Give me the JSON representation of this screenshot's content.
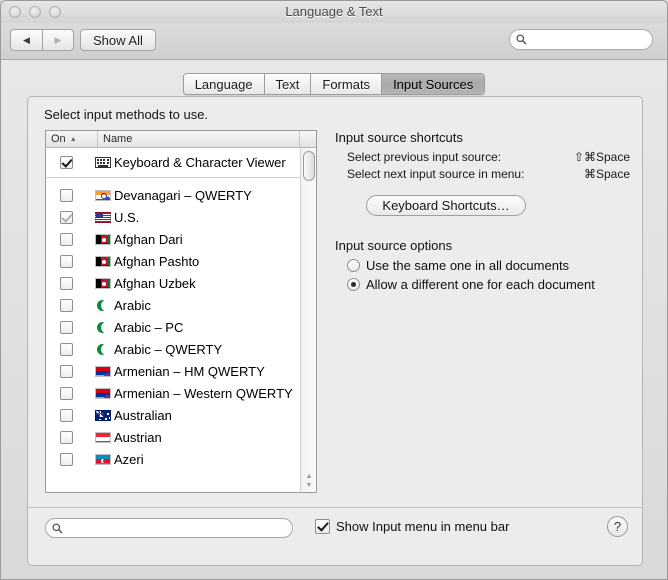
{
  "window": {
    "title": "Language & Text",
    "traffic_lights": [
      "close-button",
      "minimize-button",
      "zoom-button"
    ]
  },
  "toolbar": {
    "back_label": "◀",
    "forward_label": "▶",
    "show_all_label": "Show All",
    "search_value": "",
    "search_placeholder": ""
  },
  "tabs": [
    {
      "label": "Language",
      "active": false
    },
    {
      "label": "Text",
      "active": false
    },
    {
      "label": "Formats",
      "active": false
    },
    {
      "label": "Input Sources",
      "active": true
    }
  ],
  "main": {
    "prompt": "Select input methods to use.",
    "list_headers": {
      "on": "On",
      "sort_arrow": "▲",
      "name": "Name"
    },
    "input_methods": [
      {
        "name": "Keyboard & Character Viewer",
        "checked": true,
        "dim": false,
        "icon": "keyboard-viewer-icon",
        "separator": true
      },
      {
        "name": "Devanagari – QWERTY",
        "checked": false,
        "dim": false,
        "icon": "devanagari-flag-icon"
      },
      {
        "name": "U.S.",
        "checked": true,
        "dim": true,
        "icon": "us-flag-icon"
      },
      {
        "name": "Afghan Dari",
        "checked": false,
        "dim": false,
        "icon": "afghanistan-flag-icon"
      },
      {
        "name": "Afghan Pashto",
        "checked": false,
        "dim": false,
        "icon": "afghanistan-flag-icon"
      },
      {
        "name": "Afghan Uzbek",
        "checked": false,
        "dim": false,
        "icon": "afghanistan-flag-icon"
      },
      {
        "name": "Arabic",
        "checked": false,
        "dim": false,
        "icon": "arabic-crescent-icon"
      },
      {
        "name": "Arabic – PC",
        "checked": false,
        "dim": false,
        "icon": "arabic-crescent-icon"
      },
      {
        "name": "Arabic – QWERTY",
        "checked": false,
        "dim": false,
        "icon": "arabic-crescent-icon"
      },
      {
        "name": "Armenian – HM QWERTY",
        "checked": false,
        "dim": false,
        "icon": "armenia-flag-icon"
      },
      {
        "name": "Armenian – Western QWERTY",
        "checked": false,
        "dim": false,
        "icon": "armenia-flag-icon"
      },
      {
        "name": "Australian",
        "checked": false,
        "dim": false,
        "icon": "australia-flag-icon"
      },
      {
        "name": "Austrian",
        "checked": false,
        "dim": false,
        "icon": "austria-flag-icon"
      },
      {
        "name": "Azeri",
        "checked": false,
        "dim": false,
        "icon": "azerbaijan-flag-icon"
      }
    ],
    "shortcuts_section": {
      "title": "Input source shortcuts",
      "rows": [
        {
          "label": "Select previous input source:",
          "keys": "⇧⌘Space"
        },
        {
          "label": "Select next input source in menu:",
          "keys": "⌘Space"
        }
      ],
      "button_label": "Keyboard Shortcuts…"
    },
    "options_section": {
      "title": "Input source options",
      "options": [
        {
          "label": "Use the same one in all documents",
          "selected": false
        },
        {
          "label": "Allow a different one for each document",
          "selected": true
        }
      ]
    }
  },
  "bottom": {
    "search_value": "",
    "search_placeholder": "",
    "show_input_menu_label": "Show Input menu in menu bar",
    "show_input_menu_checked": true,
    "help_label": "?"
  },
  "colors": {
    "window_bg": "#ececec",
    "selected_tab": "#b0b0b0",
    "list_bg": "#ffffff"
  }
}
